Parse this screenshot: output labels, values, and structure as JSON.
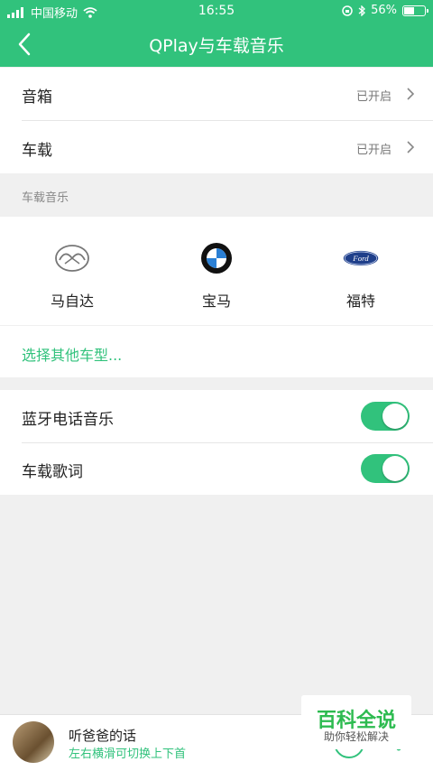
{
  "status_bar": {
    "carrier": "中国移动",
    "time": "16:55",
    "battery_percent": "56%",
    "battery_level": 0.56
  },
  "nav": {
    "title": "QPlay与车载音乐"
  },
  "devices": [
    {
      "label": "音箱",
      "status": "已开启"
    },
    {
      "label": "车载",
      "status": "已开启"
    }
  ],
  "car_music": {
    "section_title": "车载音乐",
    "brands": [
      {
        "name": "马自达",
        "icon": "mazda-logo-icon"
      },
      {
        "name": "宝马",
        "icon": "bmw-logo-icon"
      },
      {
        "name": "福特",
        "icon": "ford-logo-icon",
        "logo_text": "Ford"
      }
    ],
    "other_link": "选择其他车型..."
  },
  "toggles": [
    {
      "label": "蓝牙电话音乐",
      "on": true
    },
    {
      "label": "车载歌词",
      "on": true
    }
  ],
  "player": {
    "song": "听爸爸的话",
    "hint": "左右横滑可切换上下首"
  },
  "watermark": {
    "title": "百科全说",
    "subtitle": "助你轻松解决"
  },
  "colors": {
    "accent": "#31c27c",
    "background": "#f0f0f0"
  }
}
